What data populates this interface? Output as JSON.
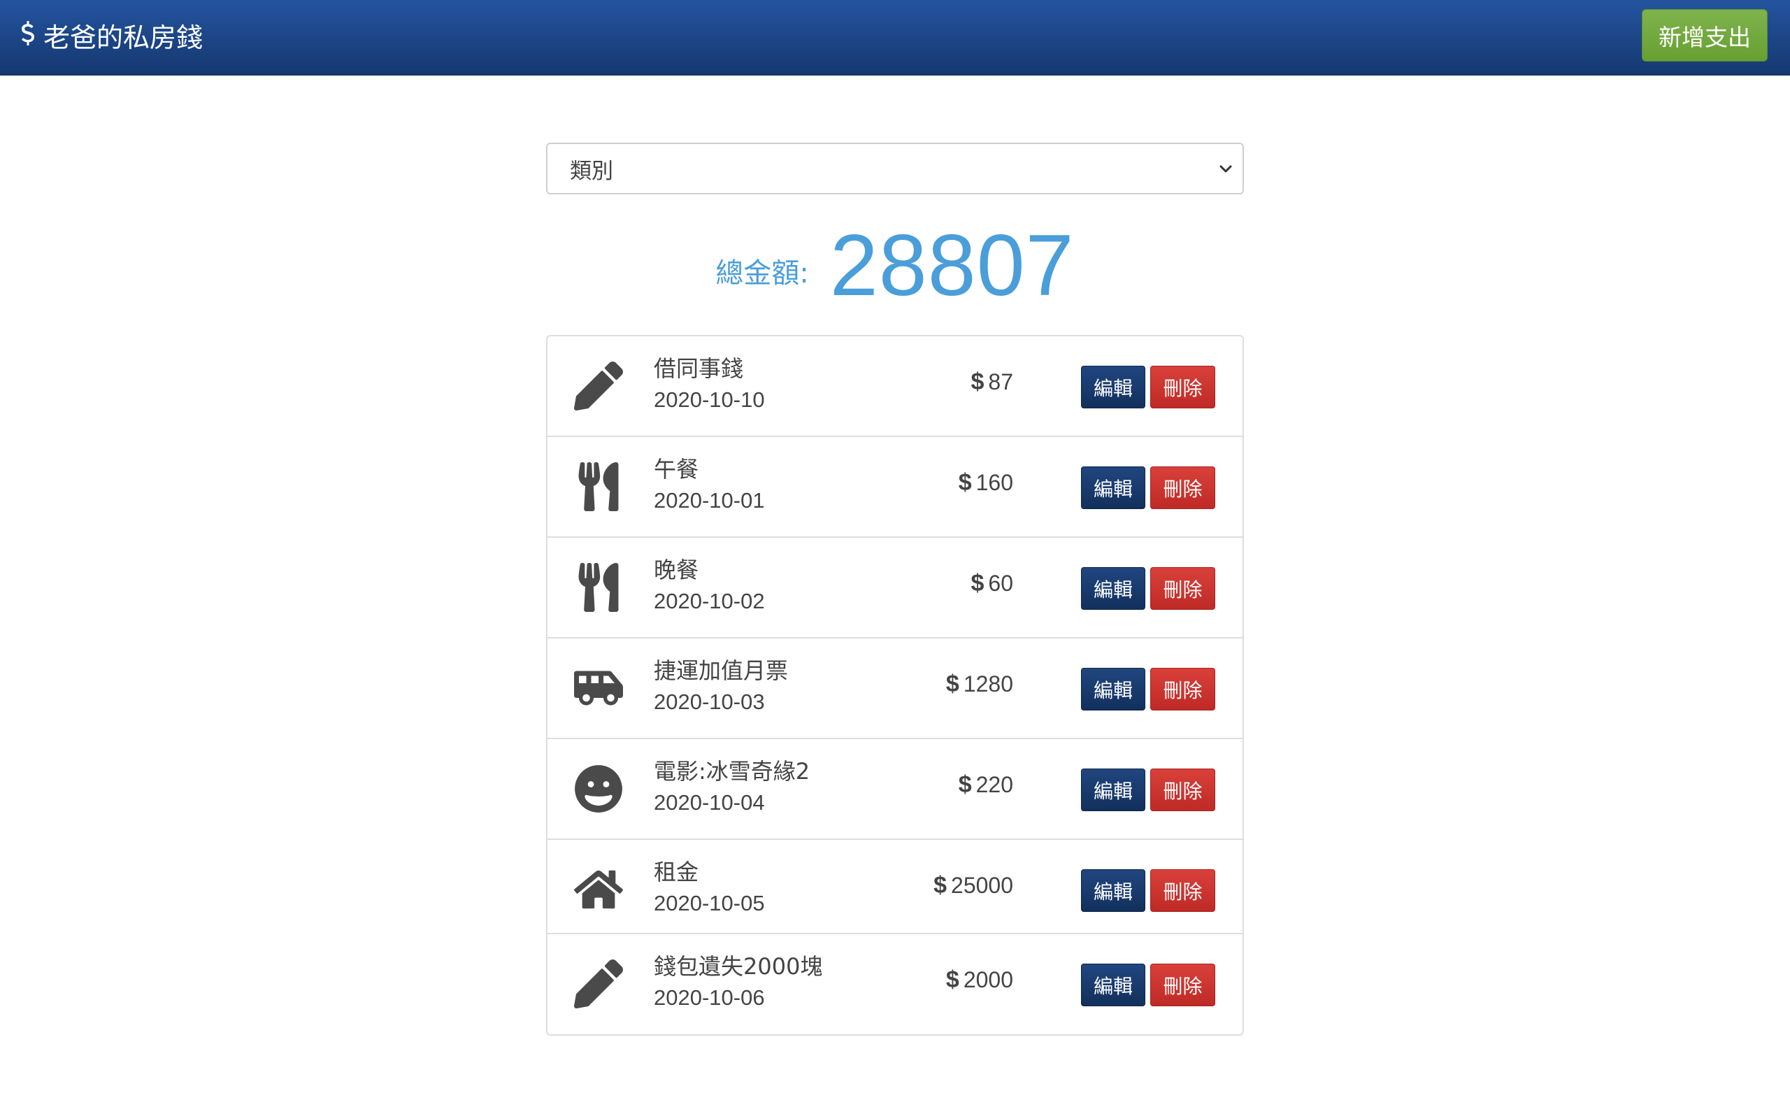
{
  "header": {
    "app_title": "老爸的私房錢",
    "add_button_label": "新增支出"
  },
  "filter": {
    "category_selected": "類別"
  },
  "summary": {
    "total_label": "總金額:",
    "total_value": "28807"
  },
  "records": [
    {
      "icon": "pencil-icon",
      "title": "借同事錢",
      "date": "2020-10-10",
      "currency": "$",
      "amount": "87",
      "edit_label": "編輯",
      "delete_label": "刪除"
    },
    {
      "icon": "utensils-icon",
      "title": "午餐",
      "date": "2020-10-01",
      "currency": "$",
      "amount": "160",
      "edit_label": "編輯",
      "delete_label": "刪除"
    },
    {
      "icon": "utensils-icon",
      "title": "晚餐",
      "date": "2020-10-02",
      "currency": "$",
      "amount": "60",
      "edit_label": "編輯",
      "delete_label": "刪除"
    },
    {
      "icon": "shuttle-van-icon",
      "title": "捷運加值月票",
      "date": "2020-10-03",
      "currency": "$",
      "amount": "1280",
      "edit_label": "編輯",
      "delete_label": "刪除"
    },
    {
      "icon": "grin-icon",
      "title": "電影:冰雪奇緣2",
      "date": "2020-10-04",
      "currency": "$",
      "amount": "220",
      "edit_label": "編輯",
      "delete_label": "刪除"
    },
    {
      "icon": "home-icon",
      "title": "租金",
      "date": "2020-10-05",
      "currency": "$",
      "amount": "25000",
      "edit_label": "編輯",
      "delete_label": "刪除"
    },
    {
      "icon": "pencil-icon",
      "title": "錢包遺失2000塊",
      "date": "2020-10-06",
      "currency": "$",
      "amount": "2000",
      "edit_label": "編輯",
      "delete_label": "刪除"
    }
  ],
  "colors": {
    "navbar": "#1d4788",
    "add_button": "#72a83f",
    "total_text": "#4a9ed9",
    "edit_button": "#17386b",
    "delete_button": "#cc3430"
  }
}
